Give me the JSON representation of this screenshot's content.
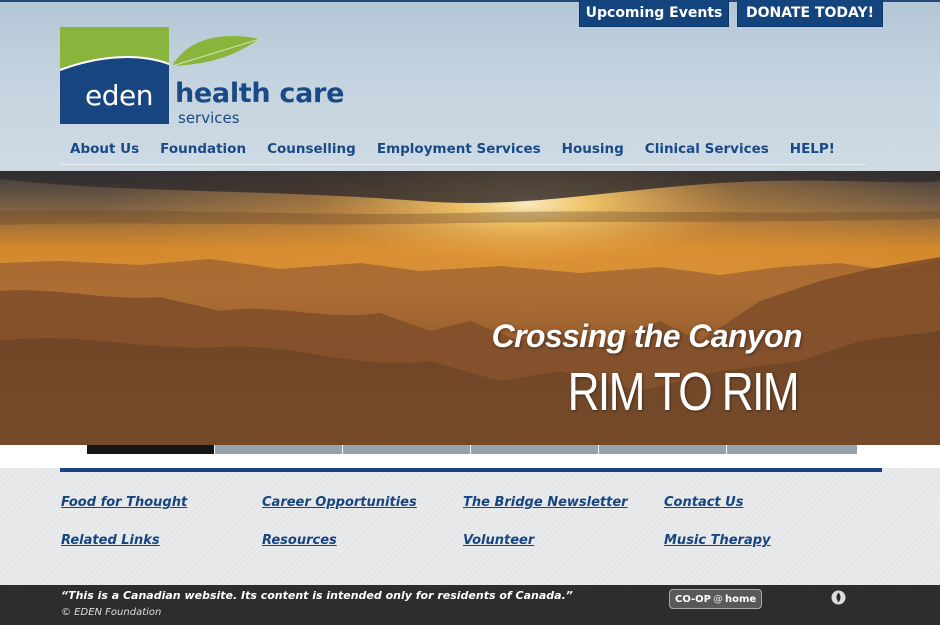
{
  "colors": {
    "brand_blue": "#14447d",
    "link_blue": "#164580",
    "leaf_green": "#8ab53c",
    "footer_dark": "#2d2d2d"
  },
  "header": {
    "top_buttons": {
      "events": "Upcoming Events",
      "donate": "DONATE TODAY!"
    },
    "logo": {
      "eden": "eden",
      "health_care": "health care",
      "services": "services"
    },
    "nav": [
      "About Us",
      "Foundation",
      "Counselling",
      "Employment Services",
      "Housing",
      "Clinical Services",
      "HELP!"
    ]
  },
  "hero": {
    "subtitle": "Crossing the Canyon",
    "title": "RIM TO RIM"
  },
  "slider": {
    "tab_count": 6,
    "active_index": 0
  },
  "footer_links": {
    "col1": [
      "Food for Thought",
      "Related Links"
    ],
    "col2": [
      "Career Opportunities",
      "Resources"
    ],
    "col3": [
      "The Bridge Newsletter",
      "Volunteer"
    ],
    "col4": [
      "Contact Us",
      "Music Therapy"
    ]
  },
  "footer": {
    "disclaimer": "“This is a Canadian website. Its content is intended only for residents of Canada.”",
    "copyright": "© EDEN Foundation",
    "coop_left": "CO-OP",
    "coop_at": "@",
    "coop_right": "home",
    "icon": "flame-icon"
  }
}
